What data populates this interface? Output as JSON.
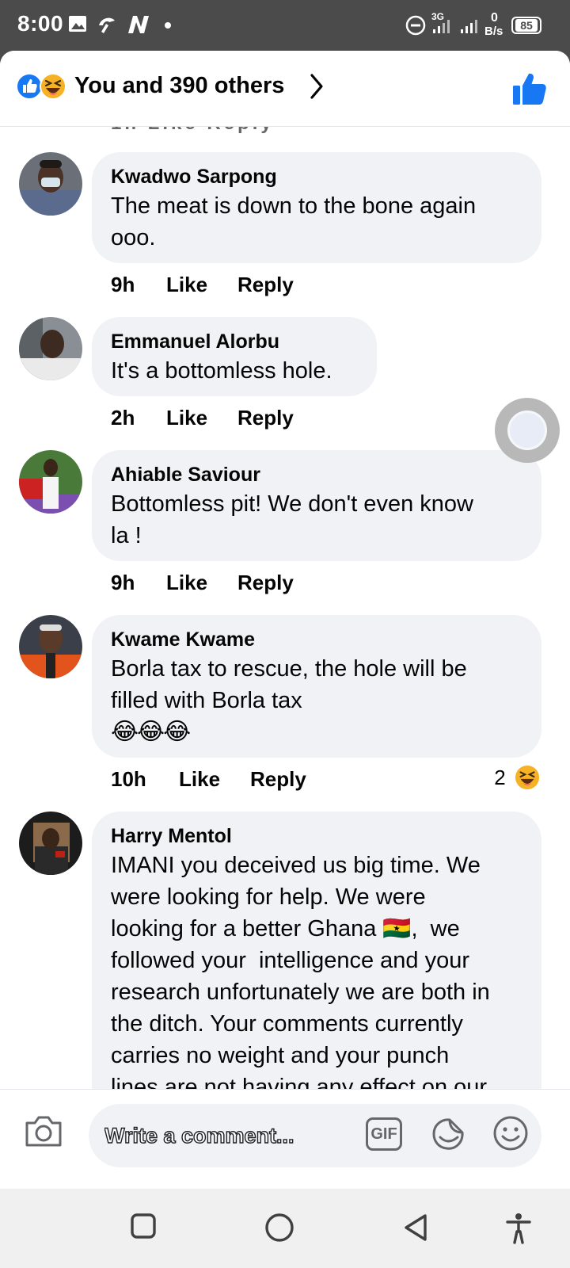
{
  "status_bar": {
    "time": "8:00",
    "network": "3G",
    "speed_value": "0",
    "speed_unit": "B/s",
    "battery": "85"
  },
  "header": {
    "reactions_text": "You and 390 others",
    "reaction_icons": [
      "like-reaction-icon",
      "haha-reaction-icon"
    ]
  },
  "comments": [
    {
      "name": "Kwadwo Sarpong",
      "text": "The meat is down to the bone again\nooo.",
      "time": "9h",
      "like": "Like",
      "reply": "Reply"
    },
    {
      "name": "Emmanuel Alorbu",
      "text": "It's a bottomless hole.",
      "time": "2h",
      "like": "Like",
      "reply": "Reply"
    },
    {
      "name": "Ahiable Saviour",
      "text": "Bottomless pit! We don't even know\nla !",
      "time": "9h",
      "like": "Like",
      "reply": "Reply"
    },
    {
      "name": "Kwame Kwame",
      "text": "Borla tax to rescue, the hole will be\nfilled with Borla tax",
      "emoji": "😂😂😂",
      "time": "10h",
      "like": "Like",
      "reply": "Reply",
      "reaction_count": "2"
    },
    {
      "name": "Harry Mentol",
      "text": "IMANI you deceived us big time. We\nwere looking for help. We were\nlooking for a better Ghana 🇬🇭,  we\nfollowed your  intelligence and your\nresearch unfortunately we are both in\nthe ditch. Your comments currently\ncarries no weight and your punch\nlines are not having any effect on our"
    }
  ],
  "composer": {
    "placeholder": "Write a comment...",
    "gif_label": "GIF"
  },
  "colors": {
    "accent": "#1877f2",
    "bubble": "#f0f2f5",
    "status_bar": "#4b4b4b"
  }
}
